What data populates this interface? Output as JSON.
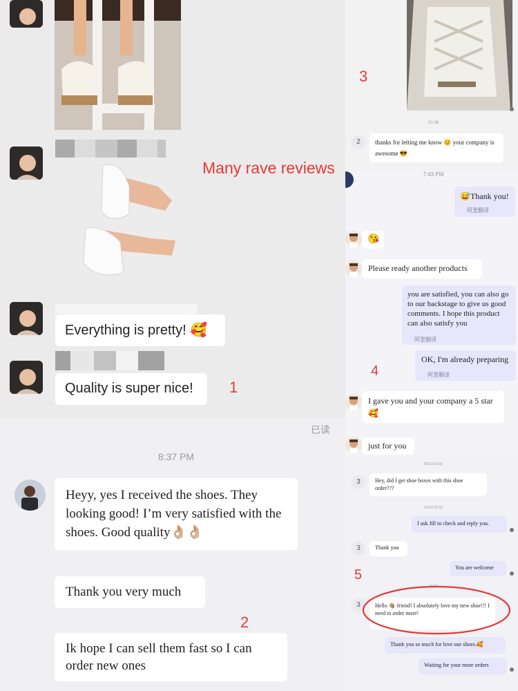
{
  "annotations": {
    "headline": "Many rave reviews",
    "n1": "1",
    "n2": "2",
    "n3": "3",
    "n4": "4",
    "n5": "5"
  },
  "panel1": {
    "msg1": "Everything is pretty! 🥰",
    "msg2": "Quality is super nice!"
  },
  "panel2": {
    "read_status": "已读",
    "time": "8:37 PM",
    "msg1": "Heyy, yes I received the shoes. They looking good! I’m very satisfied with the shoes. Good quality👌🏼👌🏼",
    "msg2": "Thank you very much",
    "msg3": "Ik hope I can sell them fast so I can order new ones"
  },
  "panel3": {
    "time1": "21:38",
    "badge": "2",
    "msg1": "thanks for letting me know 😊 your company is awesome 😎"
  },
  "panel4": {
    "time": "7:43 PM",
    "my1": "😅Thank you!",
    "translate": "阿里翻译",
    "emoji_msg": "😘",
    "msg_ready": "Please ready  another products",
    "my2": "you are satisfied, you can also go to our backstage to give us good comments. I hope this product can also satisfy you",
    "my3": "OK, I'm already preparing",
    "msg_star": "I gave you and your company a 5 star 🥰",
    "msg_foryou": "just for you"
  },
  "panel5": {
    "badge": "3",
    "date1": "05/13 19:16",
    "msg1": "Hey, did I get shoe boxes with this shoe order???",
    "date2": "05/13 20:33",
    "my1": "I ask Jill to check and reply you.",
    "msg2": "Thank you",
    "my2": "You are welcome",
    "time3": "22:23",
    "msg3": "Hello 👋🏽 friend! I absolutely love my new shoe!!! I need to order more!",
    "my3": "Thank you so much for love our shoes.🥰",
    "my4": "Waiting for your more orders"
  },
  "colors": {
    "annotation_red": "#e53935",
    "my_bubble": "#e7e6fb",
    "bubble": "#ffffff"
  }
}
